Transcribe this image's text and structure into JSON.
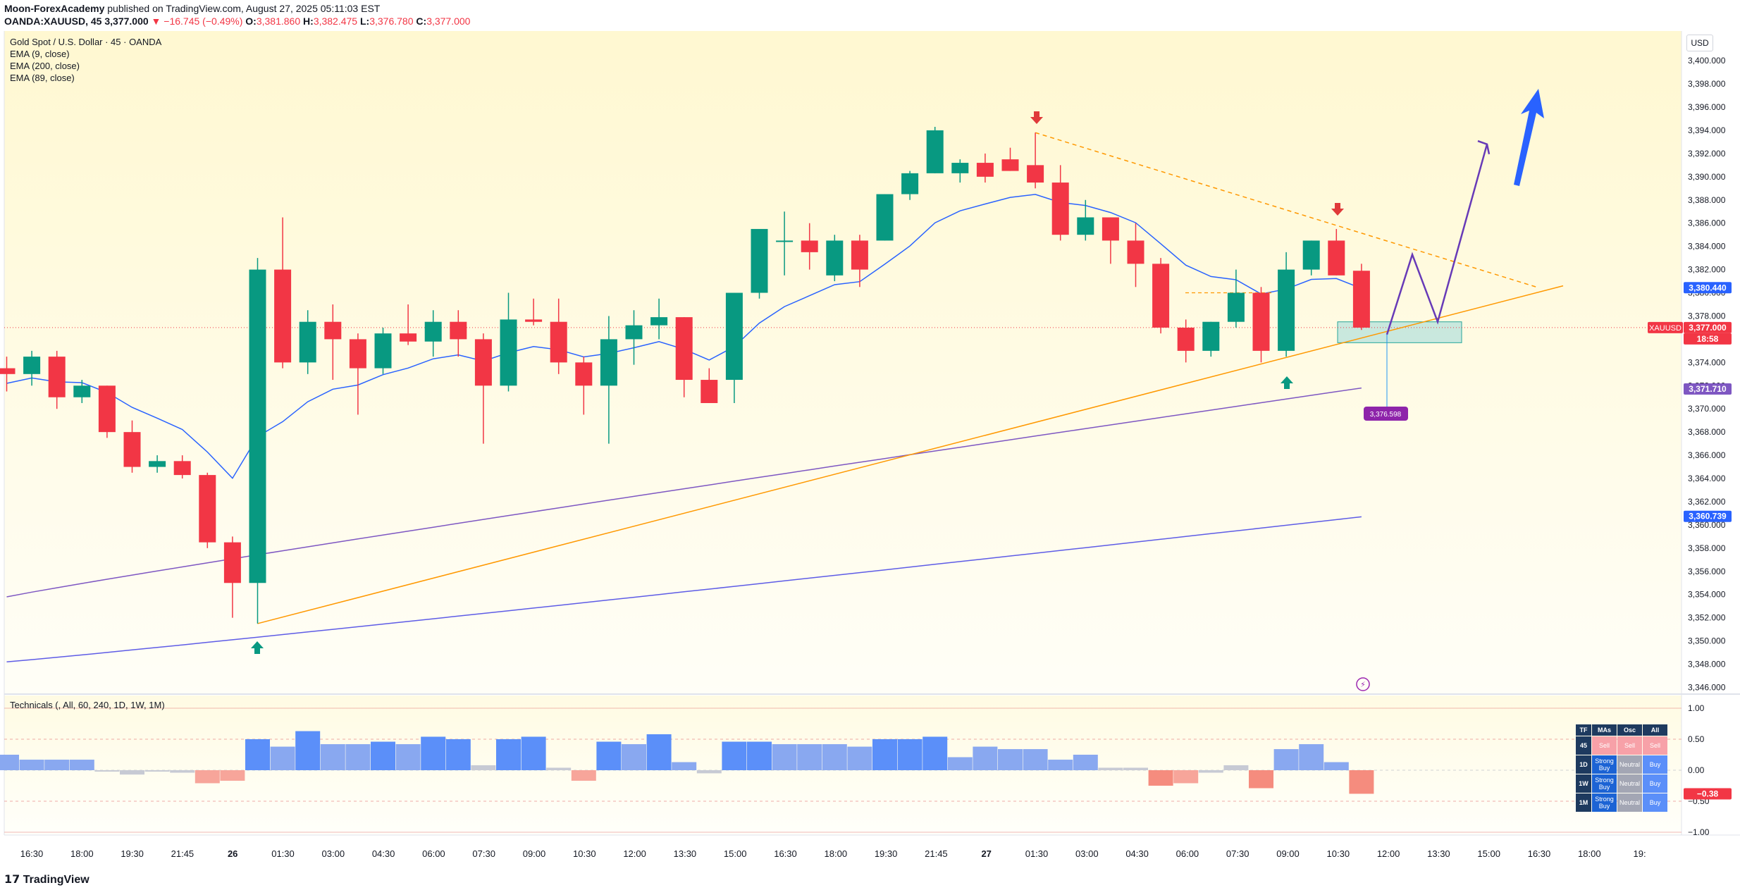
{
  "header": {
    "publisher": "Moon-ForexAcademy",
    "published_text": "published on TradingView.com, August 27, 2025 05:11:03 EST",
    "symbol": "OANDA:XAUUSD, 45",
    "last": "3,377.000",
    "change": "−16.745 (−0.49%)",
    "o_label": "O:",
    "o": "3,381.860",
    "h_label": "H:",
    "h": "3,382.475",
    "l_label": "L:",
    "l": "3,376.780",
    "c_label": "C:",
    "c": "3,377.000"
  },
  "legend": {
    "title": "Gold Spot / U.S. Dollar · 45 · OANDA",
    "ema9": "EMA (9, close)",
    "ema200": "EMA (200, close)",
    "ema89": "EMA (89, close)"
  },
  "currency_button": "USD",
  "indicator": {
    "label": "Technicals (, All, 60, 240, 1D, 1W, 1M)"
  },
  "footer": {
    "brand": "TradingView"
  },
  "colors": {
    "up": "#089981",
    "down": "#f23645",
    "ema9": "#2962ff",
    "ema89": "#7e57c2",
    "ema200": "#5e5ce6",
    "trend": "#ff9800",
    "forecast": "#673ab7",
    "arrow": "#2962ff",
    "target": "#8e24aa",
    "zone": "#b2dfdb"
  },
  "tech_table": {
    "header": [
      "TF",
      "MAs",
      "Osc",
      "All"
    ],
    "rows": [
      {
        "tf": "45",
        "mas": "Sell",
        "osc": "Sell",
        "all": "Sell"
      },
      {
        "tf": "1D",
        "mas": "Strong Buy",
        "osc": "Neutral",
        "all": "Buy"
      },
      {
        "tf": "1W",
        "mas": "Strong Buy",
        "osc": "Neutral",
        "all": "Buy"
      },
      {
        "tf": "1M",
        "mas": "Strong Buy",
        "osc": "Neutral",
        "all": "Buy"
      }
    ]
  },
  "chart_data": {
    "type": "candlestick",
    "ylim": [
      3345.5,
      3402
    ],
    "y_ticks": [
      3346,
      3348,
      3350,
      3352,
      3354,
      3356,
      3358,
      3360,
      3362,
      3364,
      3366,
      3368,
      3370,
      3372,
      3374,
      3376,
      3378,
      3380,
      3382,
      3384,
      3386,
      3388,
      3390,
      3392,
      3394,
      3396,
      3398,
      3400
    ],
    "x_tick_labels": [
      "16:30",
      "18:00",
      "19:30",
      "21:45",
      "26",
      "01:30",
      "03:00",
      "04:30",
      "06:00",
      "07:30",
      "09:00",
      "10:30",
      "12:00",
      "13:30",
      "15:00",
      "16:30",
      "18:00",
      "19:30",
      "21:45",
      "27",
      "01:30",
      "03:00",
      "04:30",
      "06:00",
      "07:30",
      "09:00",
      "10:30",
      "12:00",
      "13:30",
      "15:00",
      "16:30",
      "18:00",
      "19:"
    ],
    "candles": [
      [
        3373.5,
        3374.5,
        3371.5,
        3373
      ],
      [
        3373,
        3375,
        3372,
        3374.5
      ],
      [
        3374.5,
        3375,
        3370,
        3371
      ],
      [
        3371,
        3372.5,
        3370.5,
        3372
      ],
      [
        3372,
        3372,
        3367.5,
        3368
      ],
      [
        3368,
        3369,
        3364.5,
        3365
      ],
      [
        3365,
        3366,
        3364.5,
        3365.5
      ],
      [
        3365.5,
        3366,
        3364,
        3364.3
      ],
      [
        3364.3,
        3364.5,
        3358,
        3358.5
      ],
      [
        3358.5,
        3359,
        3352,
        3355
      ],
      [
        3355,
        3383,
        3351.5,
        3382
      ],
      [
        3382,
        3386.5,
        3373.5,
        3374
      ],
      [
        3374,
        3378.5,
        3373,
        3377.5
      ],
      [
        3377.5,
        3379,
        3372.5,
        3376
      ],
      [
        3376,
        3376.5,
        3369.5,
        3373.5
      ],
      [
        3373.5,
        3377,
        3373,
        3376.5
      ],
      [
        3376.5,
        3379,
        3375.5,
        3375.8
      ],
      [
        3375.8,
        3378.5,
        3374.5,
        3377.5
      ],
      [
        3377.5,
        3378.5,
        3374.5,
        3376
      ],
      [
        3376,
        3376.5,
        3367,
        3372
      ],
      [
        3372,
        3380,
        3371.5,
        3377.7
      ],
      [
        3377.7,
        3379.5,
        3377.2,
        3377.5
      ],
      [
        3377.5,
        3379.5,
        3373,
        3374
      ],
      [
        3374,
        3374.5,
        3369.5,
        3372
      ],
      [
        3372,
        3378,
        3367,
        3376
      ],
      [
        3376,
        3378.5,
        3373.8,
        3377.2
      ],
      [
        3377.2,
        3379.5,
        3376,
        3377.9
      ],
      [
        3377.9,
        3377.9,
        3371,
        3372.5
      ],
      [
        3372.5,
        3373.5,
        3370.5,
        3370.5
      ],
      [
        3372.5,
        3380,
        3370.5,
        3380
      ],
      [
        3380,
        3385,
        3379.5,
        3385.5
      ],
      [
        3384.5,
        3387,
        3381.5,
        3384.5
      ],
      [
        3384.5,
        3386,
        3382,
        3383.5
      ],
      [
        3381.5,
        3385,
        3381,
        3384.5
      ],
      [
        3384.5,
        3385,
        3380.5,
        3382
      ],
      [
        3384.5,
        3388.5,
        3384.5,
        3388.5
      ],
      [
        3388.5,
        3390.5,
        3388,
        3390.3
      ],
      [
        3390.3,
        3394.3,
        3390.3,
        3394
      ],
      [
        3390.3,
        3391.5,
        3389.5,
        3391.2
      ],
      [
        3391.2,
        3392,
        3389.5,
        3390
      ],
      [
        3391.5,
        3392.5,
        3390.5,
        3390.5
      ],
      [
        3391,
        3393.8,
        3389,
        3389.5
      ],
      [
        3389.5,
        3391,
        3384.5,
        3385
      ],
      [
        3385,
        3388,
        3384.5,
        3386.5
      ],
      [
        3386.5,
        3386.5,
        3382.5,
        3384.5
      ],
      [
        3384.5,
        3386,
        3380.5,
        3382.5
      ],
      [
        3382.5,
        3383,
        3376.5,
        3377
      ],
      [
        3377,
        3377.7,
        3374,
        3375
      ],
      [
        3375,
        3377.5,
        3374.5,
        3377.5
      ],
      [
        3377.5,
        3382,
        3377,
        3380
      ],
      [
        3380,
        3380.5,
        3374,
        3375
      ],
      [
        3375,
        3383.5,
        3374.5,
        3382
      ],
      [
        3382,
        3384.5,
        3381.5,
        3384.5
      ],
      [
        3384.5,
        3385.5,
        3381.5,
        3381.5
      ],
      [
        3381.9,
        3382.5,
        3376.8,
        3377
      ]
    ],
    "technicals": [
      0.25,
      0.17,
      0.17,
      0.17,
      -0.02,
      -0.07,
      -0.02,
      -0.04,
      -0.21,
      -0.17,
      0.5,
      0.38,
      0.63,
      0.42,
      0.42,
      0.46,
      0.42,
      0.54,
      0.5,
      0.08,
      0.5,
      0.54,
      0.04,
      -0.17,
      0.46,
      0.42,
      0.58,
      0.13,
      -0.05,
      0.46,
      0.46,
      0.42,
      0.42,
      0.42,
      0.38,
      0.5,
      0.5,
      0.54,
      0.21,
      0.38,
      0.34,
      0.34,
      0.17,
      0.25,
      0.04,
      0.04,
      -0.25,
      -0.21,
      -0.04,
      0.08,
      -0.29,
      0.34,
      0.42,
      0.13,
      -0.38
    ],
    "technicals_ylim": [
      -1,
      1
    ],
    "technicals_ticks": [
      "1.00",
      "0.50",
      "0.00",
      "−0.50",
      "−1.00"
    ],
    "price_labels": [
      {
        "text": "3,380.440",
        "value": 3380.44,
        "color": "#2962ff"
      },
      {
        "text": "XAUUSD",
        "value": 3377,
        "color": "#f23645"
      },
      {
        "text": "3,377.000",
        "value": 3377,
        "color": "#f23645"
      },
      {
        "text": "18:58",
        "value": 3377,
        "color": "#f23645"
      },
      {
        "text": "3,371.710",
        "value": 3371.71,
        "color": "#7e57c2"
      },
      {
        "text": "3,360.739",
        "value": 3360.739,
        "color": "#2962ff"
      }
    ],
    "technicals_value_label": "−0.38",
    "target_label": {
      "text": "3,376.598",
      "value": 3376.598
    }
  }
}
